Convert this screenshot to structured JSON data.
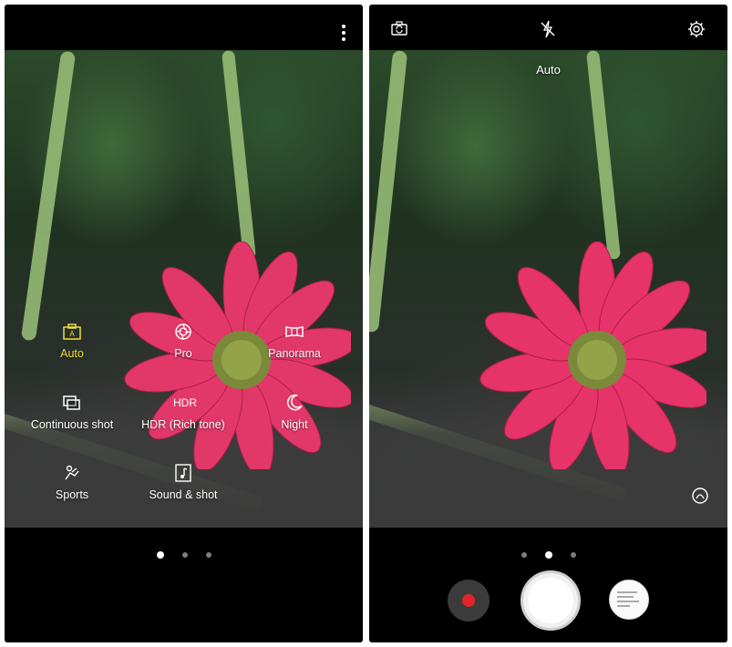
{
  "left_screen": {
    "modes": [
      {
        "label": "Auto",
        "icon": "auto-mode-icon",
        "active": true
      },
      {
        "label": "Pro",
        "icon": "aperture-icon",
        "active": false
      },
      {
        "label": "Panorama",
        "icon": "panorama-icon",
        "active": false
      },
      {
        "label": "Continuous shot",
        "icon": "continuous-shot-icon",
        "active": false
      },
      {
        "label": "HDR (Rich tone)",
        "icon": "hdr-icon",
        "icon_text": "HDR",
        "active": false
      },
      {
        "label": "Night",
        "icon": "moon-icon",
        "active": false
      },
      {
        "label": "Sports",
        "icon": "sports-icon",
        "active": false
      },
      {
        "label": "Sound & shot",
        "icon": "music-note-icon",
        "active": false
      }
    ],
    "page_indicator": {
      "count": 3,
      "current": 1
    }
  },
  "right_screen": {
    "current_mode": "Auto",
    "top_bar": {
      "icons": [
        "switch-camera-icon",
        "flash-off-icon",
        "settings-gear-icon"
      ]
    },
    "page_indicator": {
      "count": 3,
      "current": 2
    },
    "controls": {
      "record": "record-video-button",
      "shutter": "shutter-button",
      "gallery": "gallery-thumbnail"
    }
  },
  "colors": {
    "active_mode": "#f2dd38",
    "record_dot": "#e0242b",
    "background": "#000000"
  }
}
